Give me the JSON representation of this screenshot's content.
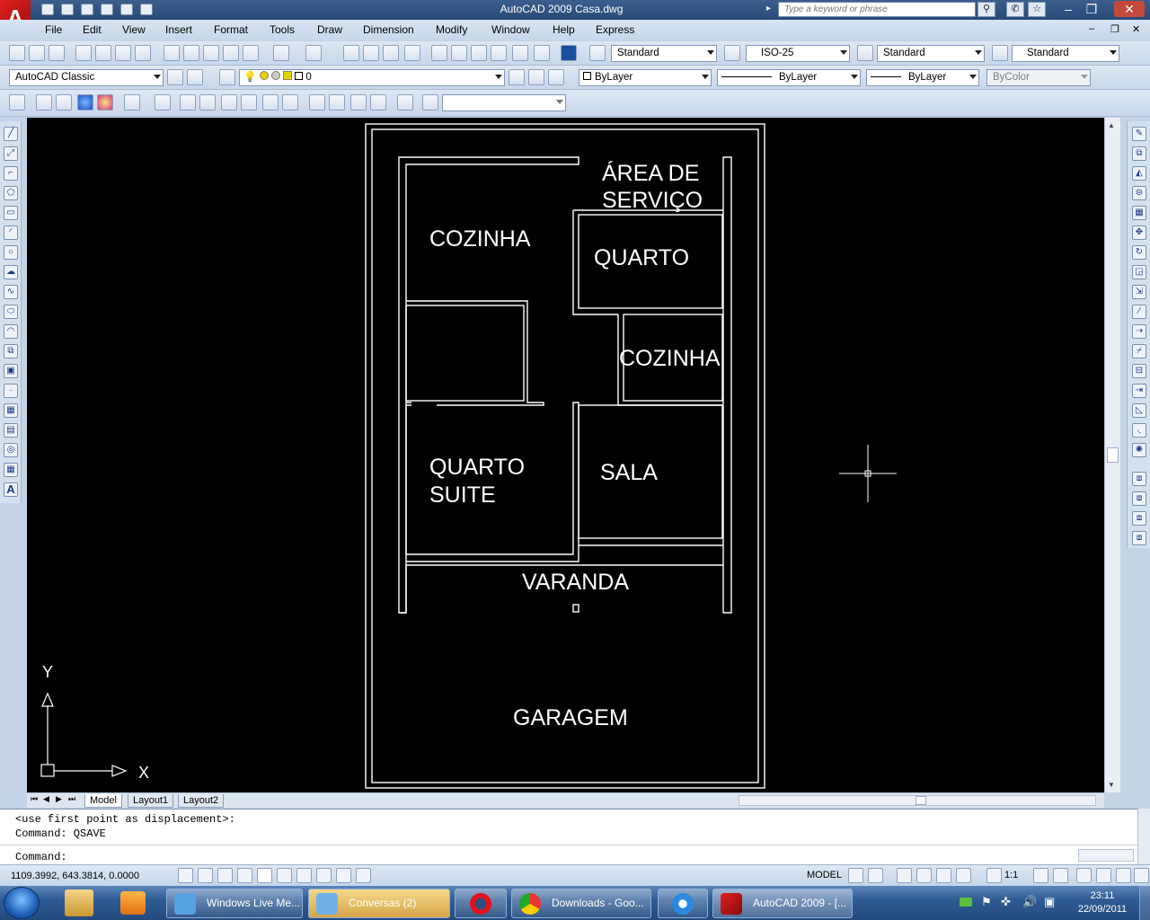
{
  "window": {
    "title": "AutoCAD 2009 Casa.dwg",
    "search_placeholder": "Type a keyword or phrase"
  },
  "app_logo": "A",
  "menus": [
    "File",
    "Edit",
    "View",
    "Insert",
    "Format",
    "Tools",
    "Draw",
    "Dimension",
    "Modify",
    "Window",
    "Help",
    "Express"
  ],
  "toolbar_styles": {
    "text_style": "Standard",
    "dim_style": "ISO-25",
    "table_style": "Standard",
    "mleader_style": "Standard"
  },
  "workspace": "AutoCAD Classic",
  "layer": "0",
  "properties": {
    "color": "ByLayer",
    "linetype": "ByLayer",
    "lineweight": "ByLayer",
    "plotstyle": "ByColor"
  },
  "drawing": {
    "rooms": [
      "ÁREA DE",
      "SERVIÇO",
      "COZINHA",
      "QUARTO",
      "COZINHA",
      "QUARTO",
      "SUITE",
      "SALA",
      "VARANDA",
      "GARAGEM"
    ]
  },
  "ucs": {
    "y_label": "Y",
    "x_label": "X"
  },
  "layout_tabs": [
    "Model",
    "Layout1",
    "Layout2"
  ],
  "command_history": [
    "<use first point as displacement>:",
    "Command: QSAVE"
  ],
  "command_prompt": "Command:",
  "status": {
    "coordinates": "1109.3992, 643.3814, 0.0000",
    "space": "MODEL",
    "annotation_scale": "1:1"
  },
  "taskbar": {
    "items": [
      "Windows Live Me...",
      "Conversas (2)",
      "",
      "Downloads - Goo...",
      "",
      "AutoCAD 2009 - [..."
    ],
    "time": "23:11",
    "date": "22/09/2011"
  },
  "colors": {
    "canvas": "#000000",
    "title_bar": "#2b4d7c",
    "autocad_red": "#c81818",
    "taskbar": "#2f5c95"
  }
}
